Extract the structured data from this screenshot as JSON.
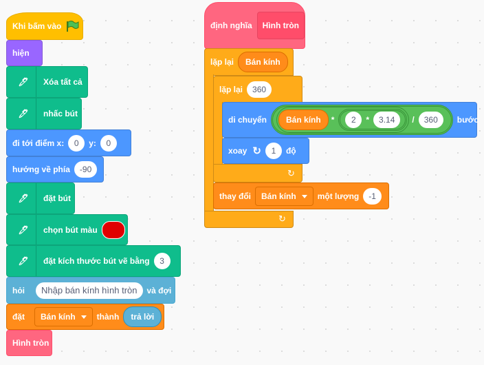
{
  "main_script": {
    "when_flag": "Khi bấm vào",
    "show": "hiện",
    "erase_all": "Xóa tất cả",
    "pen_up": "nhấc bút",
    "goto": {
      "label": "đi tới điểm x:",
      "x": "0",
      "y_label": "y:",
      "y": "0"
    },
    "point_direction": {
      "label": "hướng về phía",
      "value": "-90"
    },
    "pen_down": "đặt bút",
    "set_pen_color": {
      "label": "chọn bút màu",
      "color": "#e00000"
    },
    "set_pen_size": {
      "label": "đặt kích thước bút vẽ bằng",
      "value": "3"
    },
    "ask": {
      "label": "hỏi",
      "question": "Nhập bán kính hình tròn",
      "suffix": "và đợi"
    },
    "set_var": {
      "label": "đặt",
      "variable": "Bán kính",
      "to": "thành",
      "value": "trả lời"
    },
    "call": "Hình tròn"
  },
  "define_script": {
    "define": {
      "label": "định nghĩa",
      "name": "Hình tròn"
    },
    "repeat_outer": {
      "label": "lặp lại",
      "value": "Bán kính"
    },
    "repeat_inner": {
      "label": "lặp lại",
      "value": "360"
    },
    "move": {
      "label": "di chuyển",
      "var": "Bán kính",
      "op1": "*",
      "n1": "2",
      "op2": "*",
      "n2": "3.14",
      "op3": "/",
      "n3": "360",
      "suffix": "bước"
    },
    "turn": {
      "label": "xoay",
      "value": "1",
      "suffix": "độ"
    },
    "change": {
      "label": "thay đổi",
      "variable": "Bán kính",
      "by": "một lượng",
      "value": "-1"
    }
  },
  "colors": {
    "events": "#ffbf00",
    "looks": "#9966ff",
    "pen": "#0fbd8c",
    "motion": "#4c97ff",
    "sensing": "#5cb1d6",
    "variables": "#ff8c1a",
    "control": "#ffab19",
    "my_blocks": "#ff6680",
    "operators": "#59c059"
  }
}
